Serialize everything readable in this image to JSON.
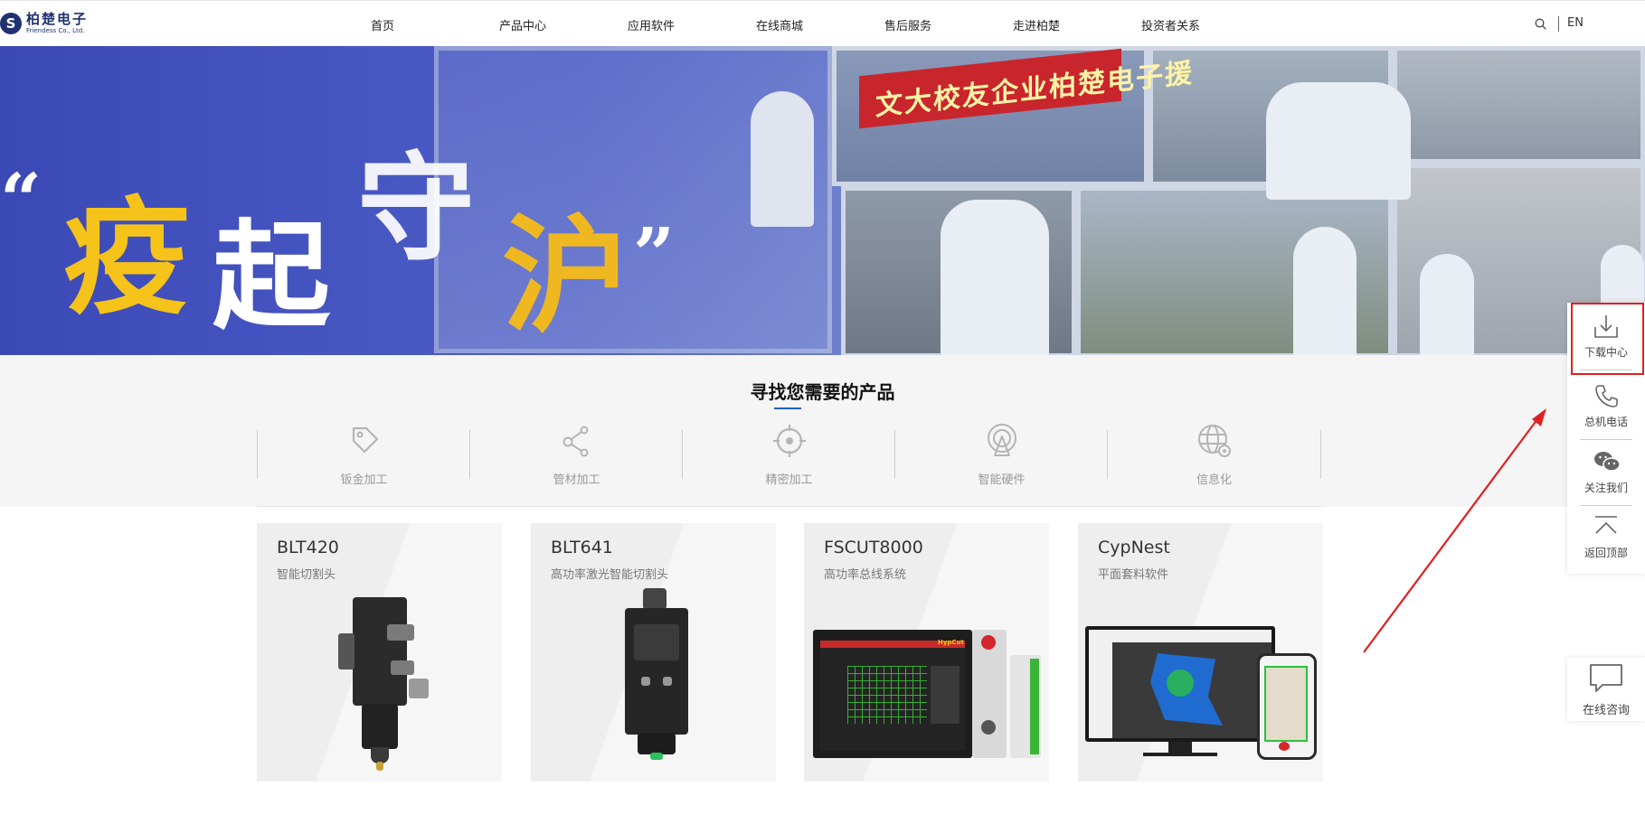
{
  "header": {
    "logo_mark": "S",
    "logo_cn": "柏楚电子",
    "logo_en": "Friendess Co., Ltd.",
    "nav": [
      {
        "label": "首页"
      },
      {
        "label": "产品中心"
      },
      {
        "label": "应用软件"
      },
      {
        "label": "在线商城"
      },
      {
        "label": "售后服务"
      },
      {
        "label": "走进柏楚"
      },
      {
        "label": "投资者关系"
      }
    ],
    "lang": "EN"
  },
  "banner": {
    "open_quote": "“",
    "chars": [
      "疫",
      "起",
      "守",
      "沪"
    ],
    "close_quote": "”",
    "red_banner": "文大校友企业柏楚电子援",
    "active_slide": 3,
    "slide_count": 3
  },
  "categories": {
    "title": "寻找您需要的产品",
    "items": [
      {
        "label": "钣金加工",
        "icon": "tag-icon"
      },
      {
        "label": "管材加工",
        "icon": "share-nodes-icon"
      },
      {
        "label": "精密加工",
        "icon": "crosshair-icon"
      },
      {
        "label": "智能硬件",
        "icon": "signal-tower-icon"
      },
      {
        "label": "信息化",
        "icon": "globe-gear-icon"
      }
    ]
  },
  "products": [
    {
      "name": "BLT420",
      "subtitle": "智能切割头"
    },
    {
      "name": "BLT641",
      "subtitle": "高功率激光智能切割头"
    },
    {
      "name": "FSCUT8000",
      "subtitle": "高功率总线系统",
      "screen_brand": "HypCut"
    },
    {
      "name": "CypNest",
      "subtitle": "平面套料软件"
    }
  ],
  "float_panel": {
    "items": [
      {
        "label": "下载中心",
        "icon": "download-icon"
      },
      {
        "label": "总机电话",
        "icon": "phone-icon"
      },
      {
        "label": "关注我们",
        "icon": "wechat-icon"
      },
      {
        "label": "返回顶部",
        "icon": "back-to-top-icon"
      }
    ],
    "highlighted": "下载中心"
  },
  "consult": {
    "label": "在线咨询",
    "icon": "chat-bubble-icon"
  },
  "colors": {
    "accent_blue": "#1f5fbf",
    "highlight_red": "#e02020",
    "logo_navy": "#1f3170"
  }
}
